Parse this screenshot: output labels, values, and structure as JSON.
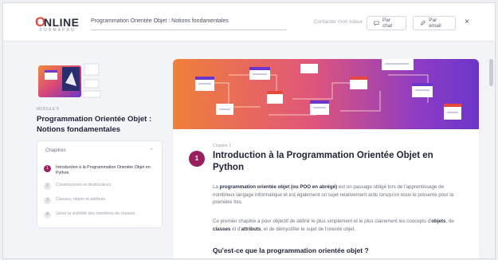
{
  "header": {
    "logo_letter": "O",
    "logo_text": "NLINE",
    "logo_sub": "FORMAPRO",
    "course_title": "Programmation Orientée Objet : Notions fondamentales",
    "contact_label": "Contacter mon tuteur",
    "chat_button": "Par chat",
    "email_button": "Par email",
    "close_symbol": "×"
  },
  "sidebar": {
    "module_label": "MODULE 6",
    "module_title": "Programmation Orientée Objet : Notions fondamentales",
    "chapters_heading": "Chapitres",
    "chapters": [
      {
        "num": "1",
        "label": "Introduction à la Programmation Orientée Objet en Python",
        "active": true
      },
      {
        "num": "2",
        "label": "Constructeurs et destructeurs",
        "active": false
      },
      {
        "num": "3",
        "label": "Classes, objets et attributs",
        "active": false
      },
      {
        "num": "4",
        "label": "Gérer la visibilité des membres de classes",
        "active": false
      }
    ]
  },
  "content": {
    "chapter_label": "Chapitre 1",
    "chapter_number": "1",
    "chapter_title": "Introduction à la Programmation Orientée Objet en Python",
    "p1": {
      "before": "La ",
      "bold": "programmation orientée objet (ou POO en abrégé)",
      "after": " est un passage obligé lors de l'apprentissage de nombreux langage informatique et est également un sujet relativement ardu lorsqu'on nous le présente pour la première fois."
    },
    "p2": {
      "before": "Ce premier chapitre a pour objectif de définir le plus simplement et le plus clairement les concepts d'",
      "b1": "objets",
      "mid1": ", de ",
      "b2": "classes",
      "mid2": " et d'",
      "b3": "attributs",
      "after": ", et de démystifier le sujet de l'orienté objet."
    },
    "section_title": "Qu'est-ce que la programmation orientée objet ?"
  },
  "colors": {
    "accent": "#9b1f5e",
    "logo_red": "#e8483b",
    "hero_orange": "#f0803a",
    "hero_purple": "#6b36c9"
  },
  "icons": {
    "chat": "chat-bubble-icon",
    "email": "pencil-icon",
    "close": "close-icon",
    "chevron": "chevron-up-icon"
  }
}
